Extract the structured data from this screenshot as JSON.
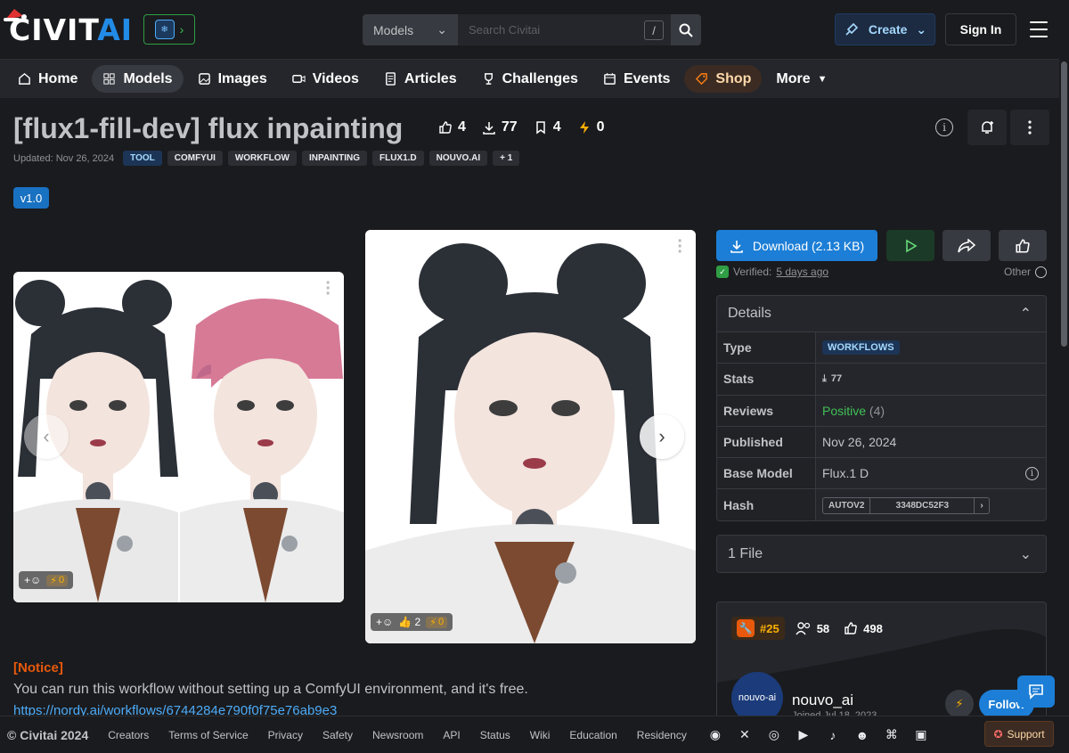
{
  "brand": {
    "logo_text_a": "CIVIT",
    "logo_text_b": "AI"
  },
  "search": {
    "category": "Models",
    "placeholder": "Search Civitai",
    "shortcut": "/"
  },
  "header": {
    "create_label": "Create",
    "signin_label": "Sign In"
  },
  "nav": [
    {
      "label": "Home",
      "icon": "home-icon"
    },
    {
      "label": "Models",
      "icon": "grid-icon",
      "active": true
    },
    {
      "label": "Images",
      "icon": "image-icon"
    },
    {
      "label": "Videos",
      "icon": "video-icon"
    },
    {
      "label": "Articles",
      "icon": "article-icon"
    },
    {
      "label": "Challenges",
      "icon": "trophy-icon"
    },
    {
      "label": "Events",
      "icon": "calendar-icon"
    },
    {
      "label": "Shop",
      "icon": "shop-icon"
    },
    {
      "label": "More",
      "icon": "caret-down-icon"
    }
  ],
  "model": {
    "title": "[flux1-fill-dev] flux inpainting",
    "likes": "4",
    "downloads": "77",
    "bookmarks": "4",
    "buzz": "0",
    "updated": "Updated: Nov 26, 2024",
    "tags": [
      "TOOL",
      "COMFYUI",
      "WORKFLOW",
      "INPAINTING",
      "FLUX1.D",
      "NOUVO.AI",
      "+ 1"
    ],
    "version": "v1.0"
  },
  "gallery": {
    "card1": {
      "buzz": "0"
    },
    "card2": {
      "likes": "2",
      "buzz": "0"
    }
  },
  "actions": {
    "download_label": "Download (2.13 KB)",
    "verified_label": "Verified:",
    "verified_time": "5 days ago",
    "other_label": "Other"
  },
  "details": {
    "heading": "Details",
    "rows": {
      "type_label": "Type",
      "type_value": "WORKFLOWS",
      "stats_label": "Stats",
      "stats_value": "77",
      "reviews_label": "Reviews",
      "reviews_value": "Positive",
      "reviews_count": "(4)",
      "published_label": "Published",
      "published_value": "Nov 26, 2024",
      "base_label": "Base Model",
      "base_value": "Flux.1 D",
      "hash_label": "Hash",
      "hash_type": "AUTOV2",
      "hash_value": "3348DC52F3"
    }
  },
  "files": {
    "label": "1 File"
  },
  "creator": {
    "rank": "#25",
    "followers": "58",
    "likes": "498",
    "avatar_text": "nouvo-ai",
    "name": "nouvo_ai",
    "joined": "Joined Jul 18, 2023",
    "follow_label": "Follow"
  },
  "description": {
    "notice": "[Notice]",
    "text": "You can run this workflow without setting up a ComfyUI environment, and it's free.",
    "link": "https://nordy.ai/workflows/6744284e790f0f75e76ab9e3"
  },
  "footer": {
    "copyright": "© Civitai 2024",
    "links": [
      "Creators",
      "Terms of Service",
      "Privacy",
      "Safety",
      "Newsroom",
      "API",
      "Status",
      "Wiki",
      "Education",
      "Residency"
    ],
    "support_label": "Support"
  },
  "colors": {
    "accent": "#1c7ed6",
    "background": "#1a1b1e",
    "panel": "#25262b",
    "positive": "#40c057",
    "notice": "#e8590c"
  }
}
